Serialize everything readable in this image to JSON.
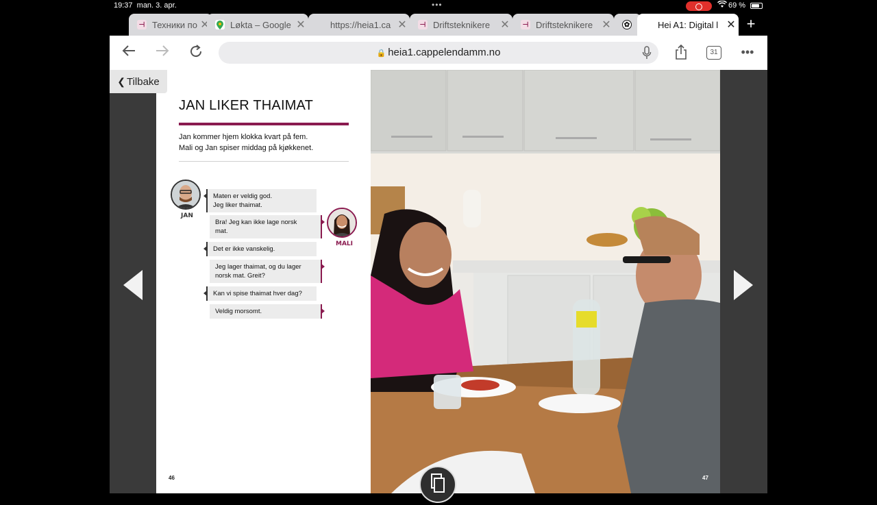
{
  "status_bar": {
    "time": "19:37",
    "date": "man. 3. apr.",
    "battery": "69 %"
  },
  "tabs": [
    {
      "title": "Техники по э",
      "favicon": "heia-icon",
      "active": false
    },
    {
      "title": "Løkta – Google",
      "favicon": "google-maps-icon",
      "active": false
    },
    {
      "title": "https://heia1.ca",
      "favicon": "",
      "active": false
    },
    {
      "title": "Driftsteknikere",
      "favicon": "heia-icon",
      "active": false
    },
    {
      "title": "Driftsteknikere",
      "favicon": "heia-icon",
      "active": false
    },
    {
      "title": "",
      "favicon": "openai-icon",
      "active": false
    },
    {
      "title": "Hei A1: Digital l",
      "favicon": "",
      "active": true
    }
  ],
  "toolbar": {
    "url": "heia1.cappelendamm.no",
    "tab_count": "31"
  },
  "content": {
    "back_label": "Tilbake",
    "lesson_title": "JAN LIKER THAIMAT",
    "intro_line1": "Jan kommer hjem klokka kvart på fem.",
    "intro_line2": "Mali og Jan spiser middag på kjøkkenet.",
    "speaker_jan": "JAN",
    "speaker_mali": "MALI",
    "dialogue": [
      {
        "speaker": "jan",
        "line1": "Maten er veldig god.",
        "line2": "Jeg liker thaimat."
      },
      {
        "speaker": "mali",
        "line1": "Bra! Jeg kan ikke lage norsk",
        "line2": "mat."
      },
      {
        "speaker": "jan",
        "line1": "Det er ikke vanskelig.",
        "line2": ""
      },
      {
        "speaker": "mali",
        "line1": "Jeg lager thaimat, og du lager",
        "line2": "norsk mat. Greit?"
      },
      {
        "speaker": "jan",
        "line1": "Kan vi spise thaimat hver dag?",
        "line2": ""
      },
      {
        "speaker": "mali",
        "line1": "Veldig morsomt.",
        "line2": ""
      }
    ],
    "page_left": "46",
    "page_right": "47"
  },
  "colors": {
    "accent": "#8a1a4f",
    "status_record": "#e0302b"
  }
}
